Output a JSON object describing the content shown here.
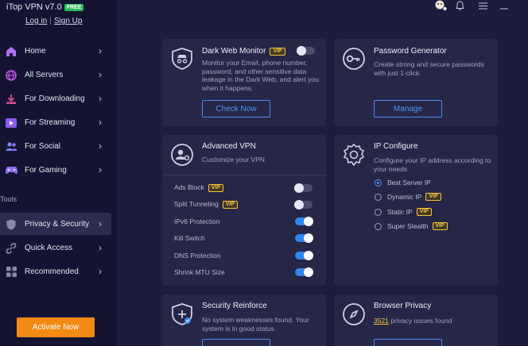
{
  "app": {
    "title": "iTop VPN v7.0",
    "badge": "FREE",
    "login": "Log in",
    "separator": "|",
    "signup": "Sign Up"
  },
  "sidebar": {
    "items": [
      {
        "label": "Home",
        "icon": "home-icon"
      },
      {
        "label": "All Servers",
        "icon": "globe-icon"
      },
      {
        "label": "For Downloading",
        "icon": "download-icon"
      },
      {
        "label": "For Streaming",
        "icon": "play-icon"
      },
      {
        "label": "For Social",
        "icon": "people-icon"
      },
      {
        "label": "For Gaming",
        "icon": "gamepad-icon"
      }
    ],
    "tools_heading": "Tools",
    "tools": [
      {
        "label": "Privacy & Security",
        "icon": "shield-icon",
        "active": true
      },
      {
        "label": "Quick Access",
        "icon": "link-icon"
      },
      {
        "label": "Recommended",
        "icon": "grid-icon"
      }
    ],
    "activate_label": "Activate Now"
  },
  "cards": {
    "dark_web": {
      "title": "Dark Web Monitor",
      "vip": "VIP",
      "desc": "Monitor your Email, phone number, password, and other sensitive data leakage in the Dark Web, and alert you when it happens.",
      "button": "Check Now"
    },
    "password": {
      "title": "Password Generator",
      "desc": "Create strong and secure passwords with just 1-click.",
      "button": "Manage"
    },
    "advanced_vpn": {
      "title": "Advanced VPN",
      "desc": "Customize your VPN",
      "options": [
        {
          "label": "Ads Block",
          "vip": "VIP",
          "on": false
        },
        {
          "label": "Split Tunneling",
          "vip": "VIP",
          "on": false
        },
        {
          "label": "IPv6 Protection",
          "on": true
        },
        {
          "label": "Kill Switch",
          "on": true
        },
        {
          "label": "DNS Protection",
          "on": true
        },
        {
          "label": "Shrink MTU Size",
          "on": true
        }
      ]
    },
    "ip_configure": {
      "title": "IP Configure",
      "desc": "Configure your IP address according to your needs",
      "options": [
        {
          "label": "Best Server IP",
          "checked": true
        },
        {
          "label": "Dynamic IP",
          "vip": "VIP"
        },
        {
          "label": "Static IP",
          "vip": "VIP"
        },
        {
          "label": "Super Stealth",
          "vip": "VIP"
        }
      ]
    },
    "security": {
      "title": "Security Reinforce",
      "desc": "No system weaknesses found. Your system is in good status"
    },
    "browser": {
      "title": "Browser Privacy",
      "count": "3521",
      "desc_suffix": " privacy issues found"
    }
  },
  "colors": {
    "accent_blue": "#2f86f0",
    "vip_gold": "#f6c33b",
    "activate_orange": "#f28a14",
    "free_green": "#2dbd5a"
  }
}
